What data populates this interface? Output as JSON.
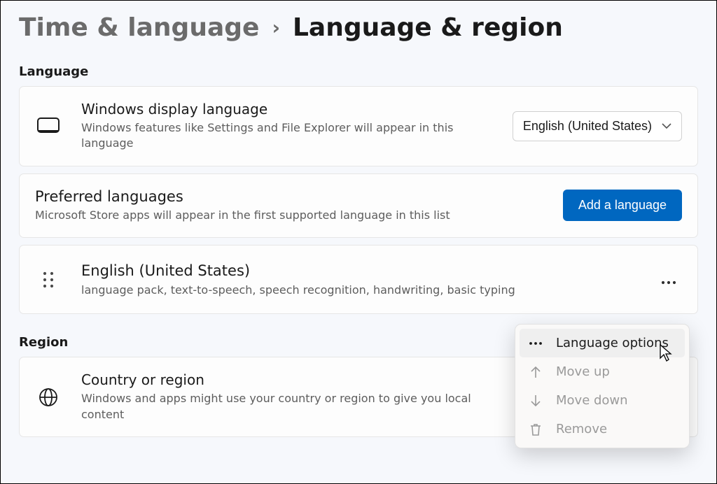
{
  "breadcrumb": {
    "parent": "Time & language",
    "current": "Language & region"
  },
  "sections": {
    "language_header": "Language",
    "region_header": "Region"
  },
  "display_language": {
    "title": "Windows display language",
    "subtitle": "Windows features like Settings and File Explorer will appear in this language",
    "selected": "English (United States)"
  },
  "preferred_languages": {
    "title": "Preferred languages",
    "subtitle": "Microsoft Store apps will appear in the first supported language in this list",
    "add_button": "Add a language"
  },
  "language_items": [
    {
      "name": "English (United States)",
      "features": "language pack, text-to-speech, speech recognition, handwriting, basic typing"
    }
  ],
  "region": {
    "title": "Country or region",
    "subtitle": "Windows and apps might use your country or region to give you local content"
  },
  "context_menu": {
    "language_options": "Language options",
    "move_up": "Move up",
    "move_down": "Move down",
    "remove": "Remove"
  }
}
